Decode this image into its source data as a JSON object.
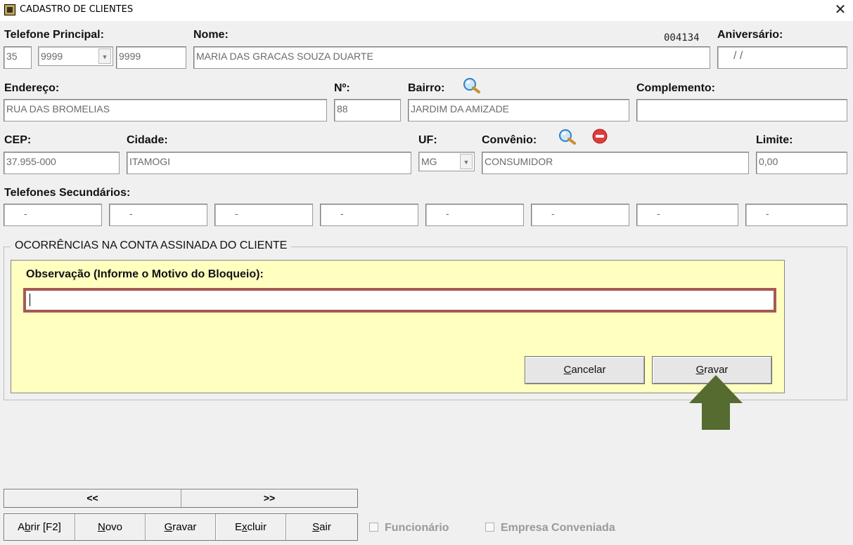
{
  "window": {
    "title": "CADASTRO DE CLIENTES",
    "close_label": "✕"
  },
  "record_number": "004134",
  "labels": {
    "telefone_principal": "Telefone Principal:",
    "nome": "Nome:",
    "aniversario": "Aniversário:",
    "endereco": "Endereço:",
    "numero": "Nº:",
    "bairro": "Bairro:",
    "complemento": "Complemento:",
    "cep": "CEP:",
    "cidade": "Cidade:",
    "uf": "UF:",
    "convenio": "Convênio:",
    "limite": "Limite:",
    "telefones_secundarios": "Telefones Secundários:"
  },
  "fields": {
    "ddd": "35",
    "prefix": "9999",
    "suffix": "9999",
    "nome": "MARIA DAS GRACAS SOUZA DUARTE",
    "aniversario": "/ /",
    "endereco": "RUA DAS BROMELIAS",
    "numero": "88",
    "bairro": "JARDIM DA AMIZADE",
    "complemento": "",
    "cep": "37.955-000",
    "cidade": "ITAMOGI",
    "uf": "MG",
    "convenio": "CONSUMIDOR",
    "limite": "0,00"
  },
  "secondary_phones": [
    "-",
    "-",
    "-",
    "-",
    "-",
    "-",
    "-",
    "-"
  ],
  "ocorrencias": {
    "title": "OCORRÊNCIAS NA CONTA ASSINADA DO CLIENTE",
    "obs_label": "Observação (Informe o Motivo do Bloqueio):",
    "obs_value": "",
    "cancel": {
      "mnemonic": "C",
      "rest": "ancelar"
    },
    "save": {
      "mnemonic": "G",
      "rest": "ravar"
    }
  },
  "nav": {
    "prev": "<<",
    "next": ">>"
  },
  "toolbar": {
    "abrir": {
      "pre": "A",
      "mnemonic": "b",
      "rest": "rir [F2]"
    },
    "novo": {
      "pre": "",
      "mnemonic": "N",
      "rest": "ovo"
    },
    "gravar": {
      "pre": "",
      "mnemonic": "G",
      "rest": "ravar"
    },
    "excluir": {
      "pre": "E",
      "mnemonic": "x",
      "rest": "cluir"
    },
    "sair": {
      "pre": "",
      "mnemonic": "S",
      "rest": "air"
    }
  },
  "checkboxes": {
    "funcionario": "Funcionário",
    "empresa": "Empresa Conveniada"
  },
  "colors": {
    "yellow_panel": "#ffffc0",
    "obs_border": "#a55a52",
    "arrow": "#556b2f"
  },
  "icons": {
    "search": "search-icon",
    "remove": "remove-icon",
    "arrow": "arrow-up-icon"
  }
}
